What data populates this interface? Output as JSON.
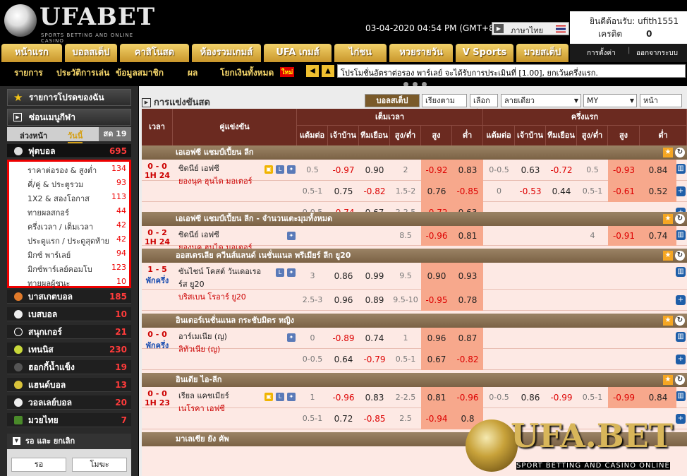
{
  "brand": {
    "logo_text": "UFABET",
    "logo_sub": "SPORTS BETTING AND ONLINE CASINO"
  },
  "datetime": "03-04-2020 04:54 PM (GMT+8)",
  "language": "ภาษาไทย",
  "account": {
    "welcome": "ยินดีต้อนรับ: ufith1551",
    "credit_label": "เครดิต",
    "credit_value": "0"
  },
  "nav_tabs": [
    "หน้าแรก",
    "บอลสเต็ป",
    "คาสิโนสด",
    "ห้องรวมเกมส์",
    "UFA เกมส์",
    "ไก่ชน",
    "หวยรายวัน",
    "V Sports",
    "มวยสเต็ป"
  ],
  "nav_right": {
    "settings": "การตั้งค่า",
    "logout": "ออกจากระบบ"
  },
  "sub_nav": [
    "รายการ",
    "ประวัติการเล่น",
    "ข้อมูลสมาชิก",
    "ผล",
    "โยกเงินทั้งหมด"
  ],
  "new_badge": "ใหม่",
  "ticker": "โปรโมชั่นอัตราต่อรอง พาร์เลย์ จะได้รับการประเมินที่ [1.00], ยกเว้นครึ่งแรก.",
  "sidebar": {
    "favorites": "รายการโปรดของฉัน",
    "hide_menu": "ซ่อนเมนูกีฬา",
    "tabs": [
      "ล่วงหน้า",
      "วันนี้",
      "สด 19"
    ],
    "sports": [
      {
        "name": "ฟุตบอล",
        "count": "695",
        "color": "#ddd"
      },
      {
        "name": "บาสเกตบอล",
        "count": "185",
        "color": "#e07a2a"
      },
      {
        "name": "เบสบอล",
        "count": "10",
        "color": "#eee"
      },
      {
        "name": "สนุกเกอร์",
        "count": "21",
        "color": "#222"
      },
      {
        "name": "เทนนิส",
        "count": "230",
        "color": "#c8d83a"
      },
      {
        "name": "ฮอกกี้น้ำแข็ง",
        "count": "19",
        "color": "#555"
      },
      {
        "name": "แฮนด์บอล",
        "count": "13",
        "color": "#d8c23a"
      },
      {
        "name": "วอลเลย์บอล",
        "count": "20",
        "color": "#eee"
      },
      {
        "name": "มวยไทย",
        "count": "7",
        "color": "#4a8a2a"
      }
    ],
    "football_sub": [
      {
        "name": "ราคาต่อรอง & สูงต่ำ",
        "count": "134"
      },
      {
        "name": "คี่/คู่ & ประตูรวม",
        "count": "93"
      },
      {
        "name": "1X2 & สองโอกาส",
        "count": "113"
      },
      {
        "name": "ทายผลสกอร์",
        "count": "44"
      },
      {
        "name": "ครึ่งเวลา / เต็มเวลา",
        "count": "42"
      },
      {
        "name": "ประตูแรก / ประตูสุดท้าย",
        "count": "42"
      },
      {
        "name": "มิกซ์ พาร์เลย์",
        "count": "94"
      },
      {
        "name": "มิกซ์พาร์เลย์คอมโบ",
        "count": "123"
      },
      {
        "name": "ทายผลผู้ชนะ",
        "count": "10"
      }
    ],
    "betslip": "รอ และ ยกเลิก",
    "btn_wait": "รอ",
    "btn_void": "โมฆะ"
  },
  "main": {
    "title": "การแข่งขันสด",
    "btn_step": "บอลสเต็ป",
    "btn_sort": "เรียงตามเวลา",
    "btn_league": "เลือกลีก",
    "sel_line": "ลายเดียว",
    "sel_odds": "MY",
    "btn_page": "หน้าปัจจุบัน",
    "head": {
      "time": "เวลา",
      "match": "คู่แข่งขัน",
      "ft": "เต็มเวลา",
      "ht": "ครึ่งแรก",
      "cols": [
        "แต้มต่อ",
        "เจ้าบ้าน",
        "ทีมเยือน",
        "สูง/ต่ำ",
        "สูง",
        "ต่ำ",
        "แต้มต่อ",
        "เจ้าบ้าน",
        "ทีมเยือน",
        "สูง/ต่ำ",
        "สูง",
        "ต่ำ"
      ]
    },
    "leagues": [
      {
        "name": "เอเอฟซี แชมป์เปี้ยน ลีก"
      },
      {
        "name": "เอเอฟซี แชมป์เปี้ยน ลีก - จำนวนเตะมุมทั้งหมด"
      },
      {
        "name": "ออสเตรเลีย ควีนส์แลนด์ เนชั่นแนล พรีเมียร์ ลีก ยู20"
      },
      {
        "name": "อินเตอร์เนชั่นแนล กระชับมิตร หญิง"
      },
      {
        "name": "อินเดีย ไอ-ลีก"
      },
      {
        "name": "มาเลเซีย ยัง คัพ"
      }
    ],
    "matches": [
      {
        "score": "0 - 0",
        "time": "1H 24",
        "home": "ซิดนีย์ เอฟซี",
        "away": "ยองนุค ฮุนได มอเตอร์",
        "icons": "tvL",
        "rows": [
          [
            "0.5",
            "-0.97",
            "0.90",
            "2",
            "-0.92",
            "0.83",
            "0-0.5",
            "0.63",
            "-0.72",
            "0.5",
            "-0.93",
            "0.84"
          ],
          [
            "0.5-1",
            "0.75",
            "-0.82",
            "1.5-2",
            "0.76",
            "-0.85",
            "0",
            "-0.53",
            "0.44",
            "0.5-1",
            "-0.61",
            "0.52"
          ],
          [
            "0-0.5",
            "-0.74",
            "0.67",
            "2-2.5",
            "-0.72",
            "0.63",
            "",
            "",
            "",
            "",
            "",
            ""
          ]
        ]
      },
      {
        "score": "0 - 2",
        "time": "1H 24",
        "home": "ซิดนีย์ เอฟซี",
        "away": "ยองนุค ฮุนได มอเตอร์",
        "icons": "",
        "rows": [
          [
            "",
            "",
            "",
            "8.5",
            "-0.96",
            "0.81",
            "",
            "",
            "",
            "4",
            "-0.91",
            "0.74"
          ]
        ]
      },
      {
        "score": "1 - 5",
        "time": "พักครึ่ง",
        "home": "ซันไชน์ โคสต์ วันเดอเรอร์ส ยู20",
        "away": "บริสเบน โรอาร์ ยู20",
        "icons": "L",
        "rows": [
          [
            "3",
            "0.86",
            "0.99",
            "9.5",
            "0.90",
            "0.93",
            "",
            "",
            "",
            "",
            "",
            ""
          ],
          [
            "2.5-3",
            "0.96",
            "0.89",
            "9.5-10",
            "-0.95",
            "0.78",
            "",
            "",
            "",
            "",
            "",
            ""
          ]
        ]
      },
      {
        "score": "0 - 0",
        "time": "พักครึ่ง",
        "home": "อาร์เมเนีย (ญ)",
        "away": "ลิทัวเนีย (ญ)",
        "icons": "",
        "rows": [
          [
            "0",
            "-0.89",
            "0.74",
            "1",
            "0.96",
            "0.87",
            "",
            "",
            "",
            "",
            "",
            ""
          ],
          [
            "0-0.5",
            "0.64",
            "-0.79",
            "0.5-1",
            "0.67",
            "-0.82",
            "",
            "",
            "",
            "",
            "",
            ""
          ]
        ]
      },
      {
        "score": "0 - 0",
        "time": "1H 23",
        "home": "เรียล แคชเมียร์",
        "away": "เนโรคา เอฟซี",
        "icons": "tvL",
        "rows": [
          [
            "1",
            "-0.96",
            "0.83",
            "2-2.5",
            "0.81",
            "-0.96",
            "0-0.5",
            "0.86",
            "-0.99",
            "0.5-1",
            "-0.99",
            "0.84"
          ],
          [
            "0.5-1",
            "0.72",
            "-0.85",
            "2.5",
            "-0.94",
            "0.8",
            "",
            "",
            "",
            "",
            "",
            ""
          ]
        ]
      }
    ]
  },
  "watermark": {
    "text": "UFA.BET",
    "sub": "SPORT BETTING AND CASINO ONLINE"
  }
}
